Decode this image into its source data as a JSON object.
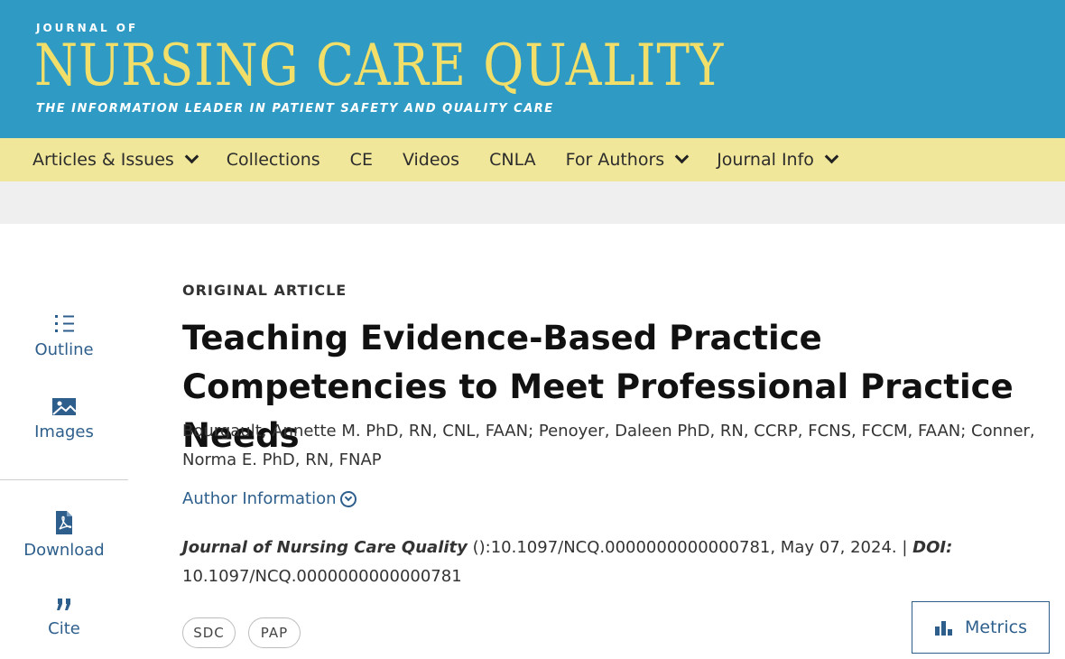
{
  "journal": {
    "logo_top": "JOURNAL OF",
    "logo_main": "NURSING CARE QUALITY",
    "tagline": "THE INFORMATION LEADER IN PATIENT SAFETY AND QUALITY CARE"
  },
  "nav": [
    {
      "label": "Articles & Issues",
      "has_dropdown": true
    },
    {
      "label": "Collections",
      "has_dropdown": false
    },
    {
      "label": "CE",
      "has_dropdown": false
    },
    {
      "label": "Videos",
      "has_dropdown": false
    },
    {
      "label": "CNLA",
      "has_dropdown": false
    },
    {
      "label": "For Authors",
      "has_dropdown": true
    },
    {
      "label": "Journal Info",
      "has_dropdown": true
    }
  ],
  "sidebar": {
    "outline": "Outline",
    "images": "Images",
    "download": "Download",
    "cite": "Cite"
  },
  "article": {
    "kicker": "ORIGINAL ARTICLE",
    "title": "Teaching Evidence-Based Practice Competencies to Meet Professional Practice Needs",
    "authors": "Bourgault, Annette M. PhD, RN, CNL, FAAN; Penoyer, Daleen PhD, RN, CCRP, FCNS, FCCM, FAAN; Conner, Norma E. PhD, RN, FNAP",
    "author_info": "Author Information",
    "journal_name": "Journal of Nursing Care Quality",
    "citation_rest": " ():10.1097/NCQ.0000000000000781, May 07, 2024. | ",
    "doi_label": "DOI:",
    "doi_value": " 10.1097/NCQ.0000000000000781"
  },
  "badges": [
    "SDC",
    "PAP"
  ],
  "metrics_label": "Metrics",
  "colors": {
    "banner": "#2f9bc4",
    "logo": "#f2df6a",
    "nav": "#f1e79a",
    "link": "#2e5f8c"
  }
}
